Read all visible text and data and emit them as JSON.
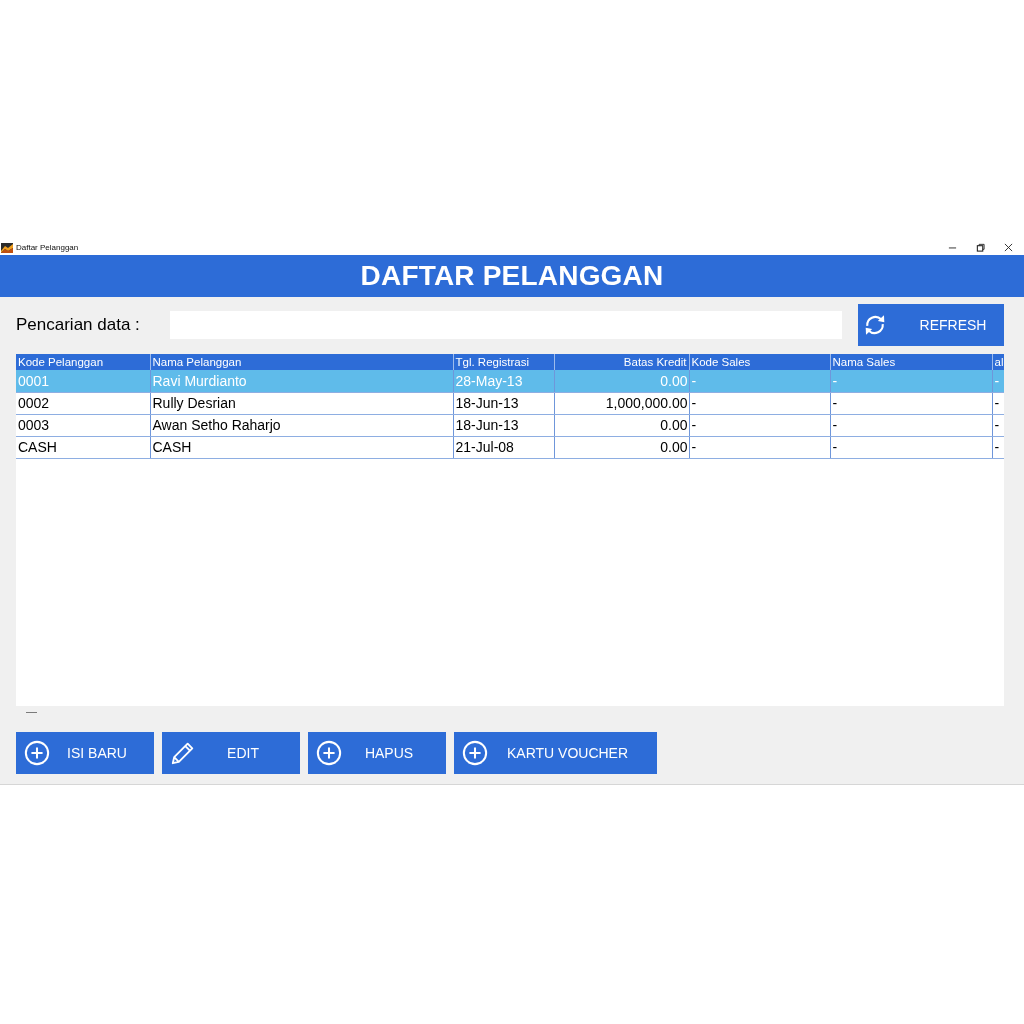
{
  "window": {
    "title": "Daftar Pelanggan"
  },
  "header": {
    "title": "DAFTAR PELANGGAN"
  },
  "search": {
    "label": "Pencarian data :"
  },
  "refresh_button": {
    "label": "REFRESH"
  },
  "table": {
    "columns": [
      {
        "label": "Kode Pelanggan",
        "kind": "text"
      },
      {
        "label": "Nama Pelanggan",
        "kind": "text"
      },
      {
        "label": "Tgl. Registrasi",
        "kind": "text"
      },
      {
        "label": "Batas Kredit",
        "kind": "number"
      },
      {
        "label": "Kode Sales",
        "kind": "text"
      },
      {
        "label": "Nama Sales",
        "kind": "text"
      },
      {
        "label": "al",
        "kind": "text"
      }
    ],
    "rows": [
      {
        "selected": true,
        "cells": [
          "0001",
          "Ravi Murdianto",
          "28-May-13",
          "0.00",
          "-",
          "-",
          "-"
        ]
      },
      {
        "selected": false,
        "cells": [
          "0002",
          "Rully Desrian",
          "18-Jun-13",
          "1,000,000.00",
          "-",
          "-",
          "-"
        ]
      },
      {
        "selected": false,
        "cells": [
          "0003",
          "Awan Setho Raharjo",
          "18-Jun-13",
          "0.00",
          "-",
          "-",
          "-"
        ]
      },
      {
        "selected": false,
        "cells": [
          "CASH",
          "CASH",
          "21-Jul-08",
          "0.00",
          "-",
          "-",
          "-"
        ]
      }
    ]
  },
  "status_label": "—",
  "buttons": [
    {
      "label": "ISI BARU",
      "kind": "standard"
    },
    {
      "label": "EDIT",
      "kind": "edit"
    },
    {
      "label": "HAPUS",
      "kind": "standard"
    },
    {
      "label": "KARTU VOUCHER",
      "kind": "standard"
    }
  ]
}
